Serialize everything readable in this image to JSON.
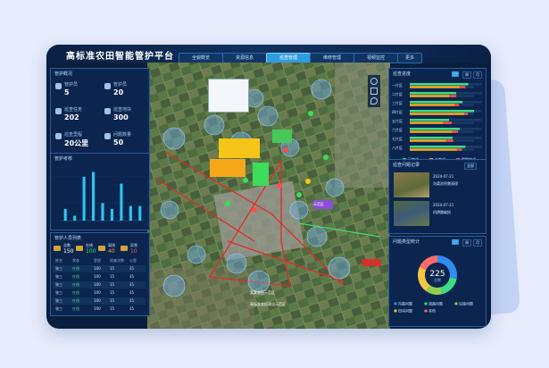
{
  "app_title": "高标准农田智能管护平台",
  "nav": [
    {
      "label": "全貌概览",
      "active": false
    },
    {
      "label": "资源信息",
      "active": false
    },
    {
      "label": "巡查管理",
      "active": true
    },
    {
      "label": "维修管理",
      "active": false
    },
    {
      "label": "视频监控",
      "active": false
    },
    {
      "label": "更多",
      "active": false
    }
  ],
  "overview": {
    "title": "管护概况",
    "stats": [
      {
        "label": "管护员",
        "value": "5"
      },
      {
        "label": "管护员",
        "value": "20"
      },
      {
        "label": "巡查任务",
        "value": "202"
      },
      {
        "label": "巡查地块",
        "value": "300"
      },
      {
        "label": "巡查里程",
        "value": "20公里"
      },
      {
        "label": "问题数量",
        "value": "50"
      }
    ]
  },
  "bar_panel": {
    "title": "管护考核"
  },
  "chart_data": {
    "type": "bar",
    "categories": [
      "",
      "",
      "",
      "",
      "",
      "",
      "",
      "",
      ""
    ],
    "values": [
      12,
      5,
      45,
      50,
      18,
      12,
      38,
      15,
      15
    ],
    "ylim": [
      0,
      55
    ],
    "color": "#29c6f2"
  },
  "personnel": {
    "title": "管护人员列表",
    "stats": [
      {
        "label": "总数",
        "value": "150",
        "color": "#ffffff"
      },
      {
        "label": "在线",
        "value": "100",
        "color": "#3ddc84"
      },
      {
        "label": "离线",
        "value": "40",
        "color": "#f5a623"
      },
      {
        "label": "异常",
        "value": "10",
        "color": "#ff5a5a"
      }
    ],
    "headers": [
      "姓名",
      "状态",
      "里程",
      "巡查次数",
      "公里"
    ],
    "rows": [
      [
        "张三",
        "在线",
        "100",
        "15",
        "35"
      ],
      [
        "张三",
        "在线",
        "100",
        "15",
        "35"
      ],
      [
        "张三",
        "在线",
        "100",
        "15",
        "35"
      ],
      [
        "张三",
        "在线",
        "100",
        "15",
        "35"
      ],
      [
        "张三",
        "在线",
        "100",
        "15",
        "35"
      ],
      [
        "张三",
        "在线",
        "100",
        "15",
        "35"
      ]
    ]
  },
  "map_labels": [
    {
      "text": "某某农田示范区"
    },
    {
      "text": "高标准农田建设示范区"
    },
    {
      "text": "示范区"
    }
  ],
  "progress_panel": {
    "title": "巡查进度",
    "tabs": [
      "日",
      "周",
      "月"
    ],
    "legend": [
      "已完成",
      "未完成",
      "超期完成"
    ],
    "rows": [
      {
        "label": "一片区",
        "done": 0.82,
        "late": 0.08
      },
      {
        "label": "二片区",
        "done": 0.65,
        "late": 0.1
      },
      {
        "label": "三片区",
        "done": 0.74,
        "late": 0.06
      },
      {
        "label": "四片区",
        "done": 0.9,
        "late": 0.05
      },
      {
        "label": "五片区",
        "done": 0.55,
        "late": 0.12
      },
      {
        "label": "六片区",
        "done": 0.7,
        "late": 0.08
      },
      {
        "label": "七片区",
        "done": 0.6,
        "late": 0.1
      },
      {
        "label": "八片区",
        "done": 0.78,
        "late": 0.07
      }
    ]
  },
  "events_panel": {
    "title": "巡查问题记录",
    "filter": "全部",
    "items": [
      {
        "date": "2024-07-21",
        "desc": "沟渠淤积需清理"
      },
      {
        "date": "2024-07-21",
        "desc": "机耕路破损"
      }
    ]
  },
  "donut_panel": {
    "title": "问题类型统计",
    "tabs": [
      "日",
      "周",
      "月"
    ],
    "total": "225",
    "total_label": "总数",
    "segments": [
      {
        "label": "沟渠问题",
        "value": 0.28,
        "color": "#2f8cf0"
      },
      {
        "label": "道路问题",
        "value": 0.18,
        "color": "#3ddc84"
      },
      {
        "label": "设施问题",
        "value": 0.14,
        "color": "#8fd14f"
      },
      {
        "label": "田块问题",
        "value": 0.22,
        "color": "#f5c542"
      },
      {
        "label": "其他",
        "value": 0.18,
        "color": "#ff6b6b"
      }
    ]
  },
  "colors": {
    "accent": "#2f9be0",
    "screen_bg": "#0a1f3f",
    "panel_border": "#2a5d9a"
  }
}
